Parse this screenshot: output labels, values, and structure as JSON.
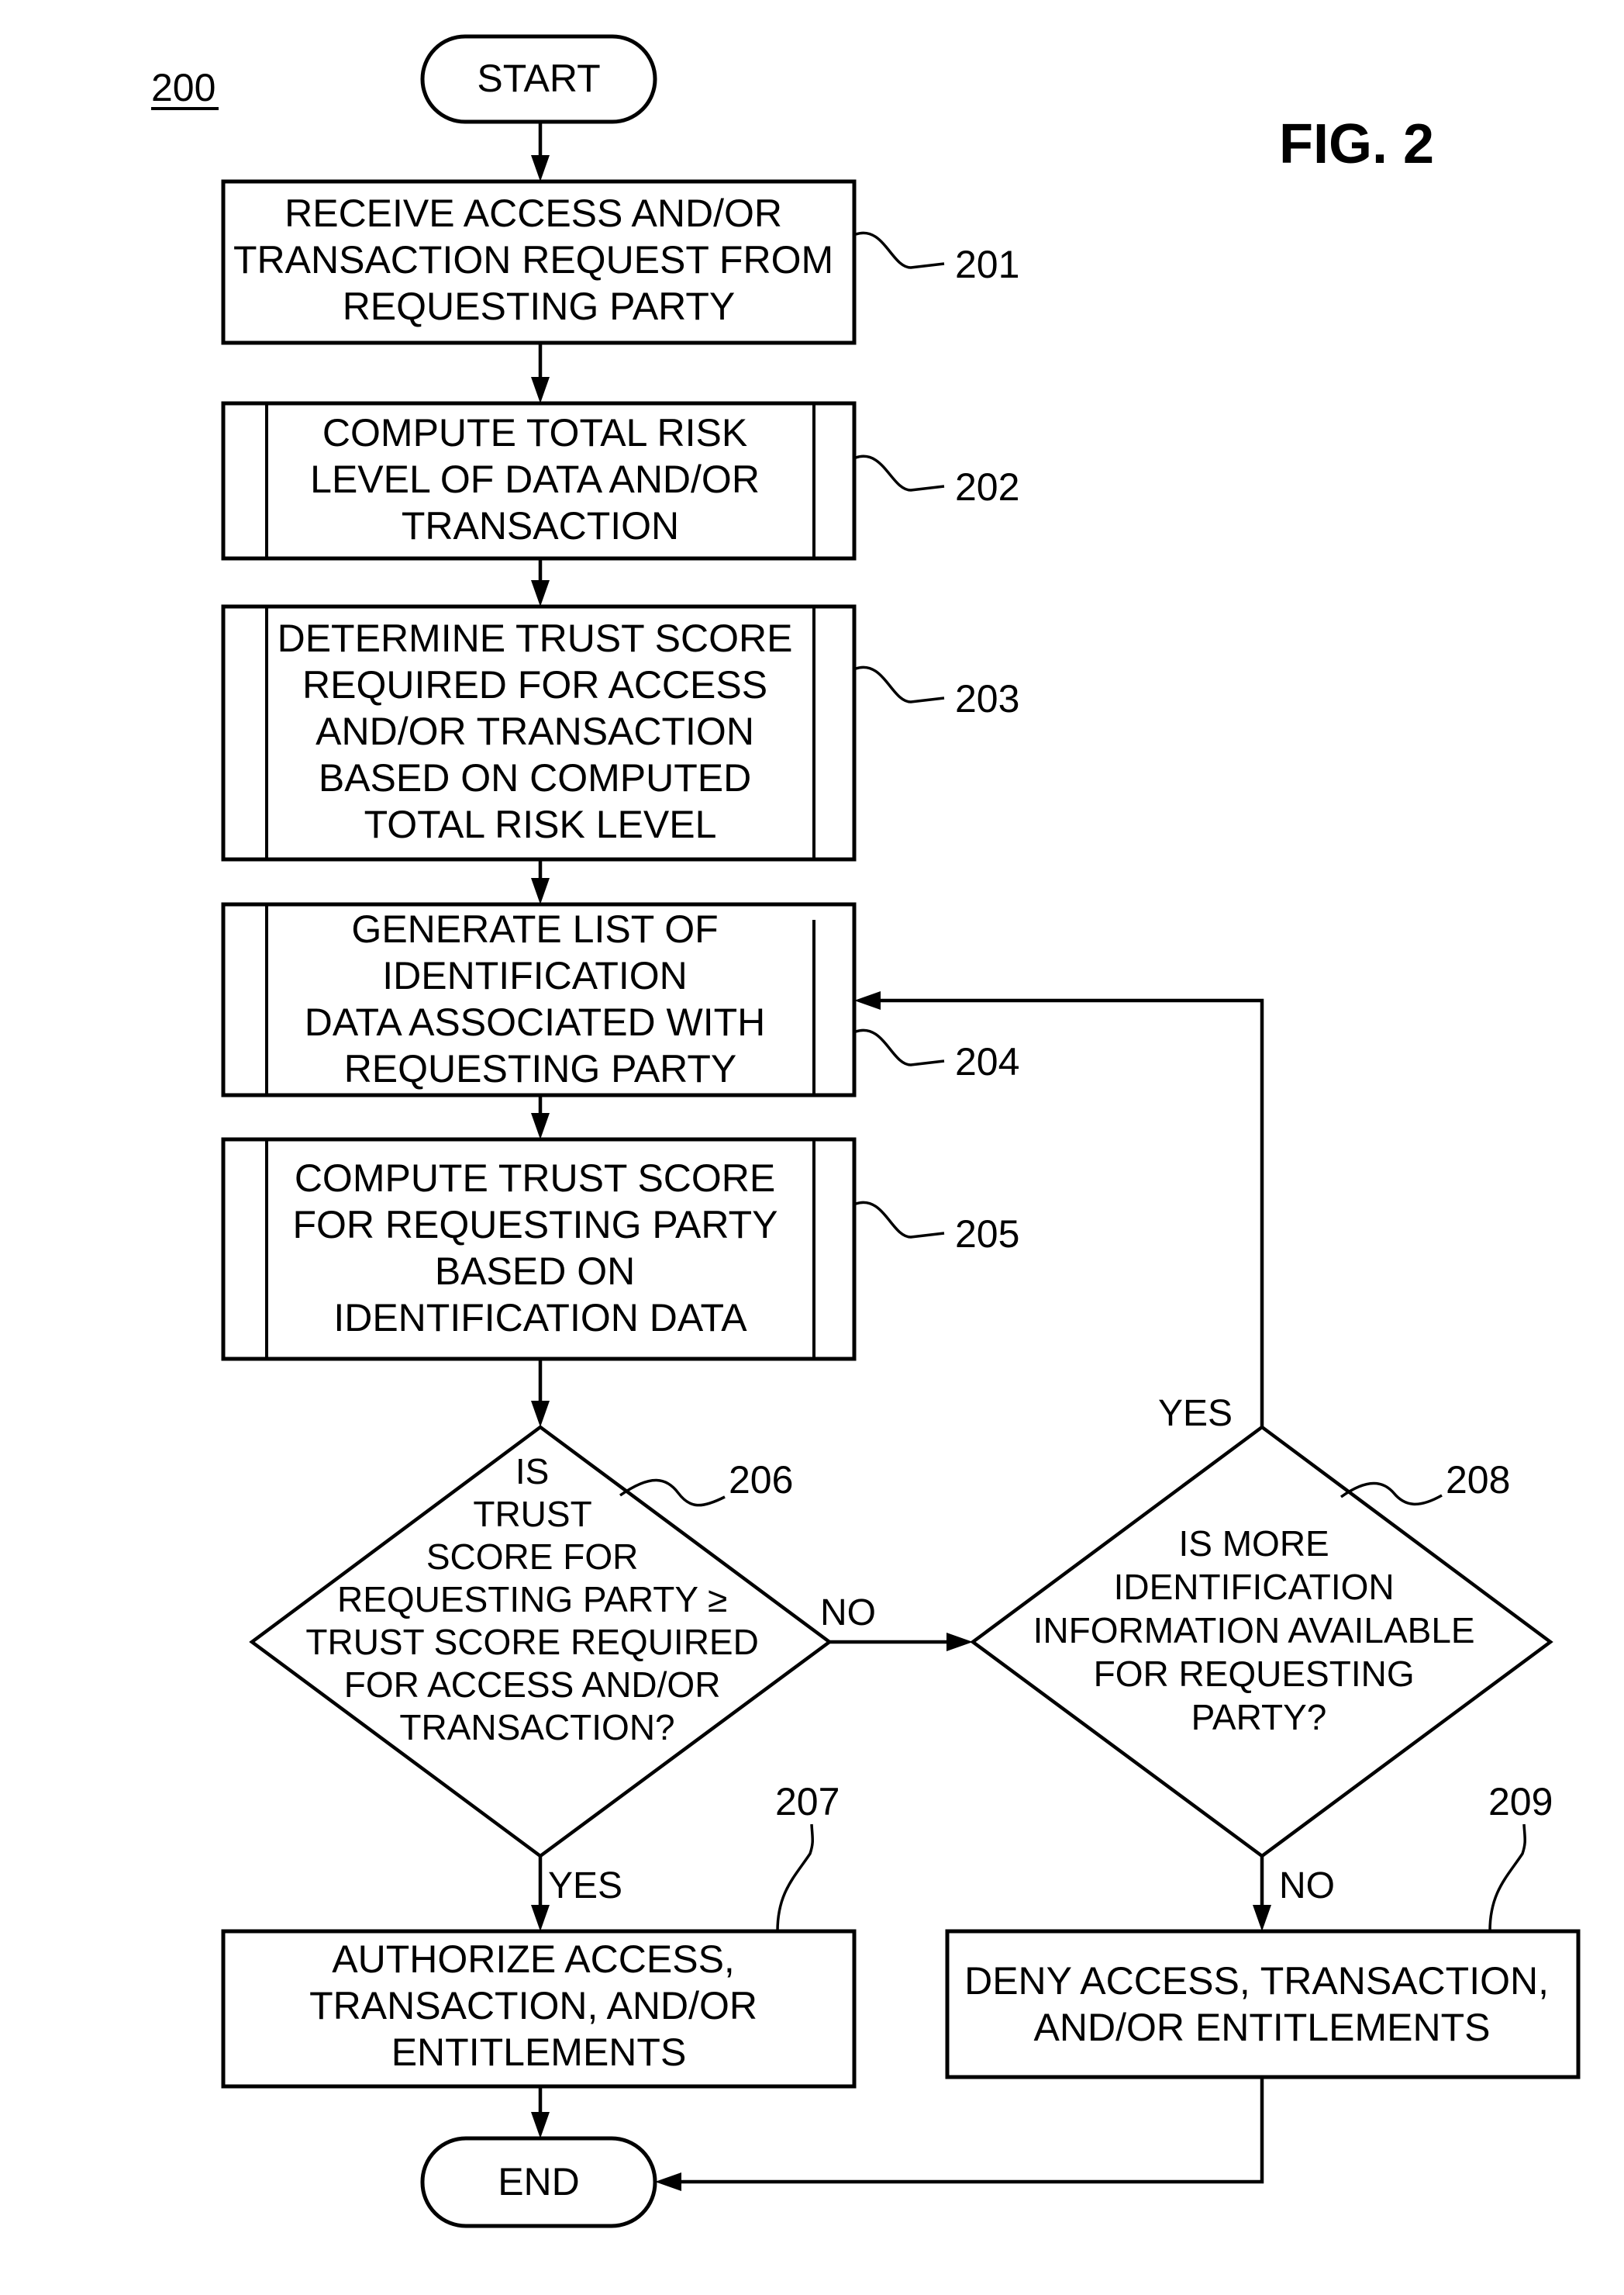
{
  "figure": {
    "number_label": "200",
    "title": "FIG. 2"
  },
  "terminals": {
    "start": "START",
    "end": "END"
  },
  "steps": [
    {
      "ref": "201",
      "lines": [
        "RECEIVE ACCESS AND/OR",
        "TRANSACTION REQUEST FROM",
        "REQUESTING PARTY"
      ]
    },
    {
      "ref": "202",
      "lines": [
        "COMPUTE TOTAL RISK",
        "LEVEL OF DATA AND/OR",
        "TRANSACTION"
      ]
    },
    {
      "ref": "203",
      "lines": [
        "DETERMINE TRUST SCORE",
        "REQUIRED FOR ACCESS",
        "AND/OR TRANSACTION",
        "BASED ON COMPUTED",
        "TOTAL RISK LEVEL"
      ]
    },
    {
      "ref": "204",
      "lines": [
        "GENERATE LIST OF",
        "IDENTIFICATION",
        "DATA ASSOCIATED WITH",
        "REQUESTING PARTY"
      ]
    },
    {
      "ref": "205",
      "lines": [
        "COMPUTE TRUST SCORE",
        "FOR REQUESTING PARTY",
        "BASED ON",
        "IDENTIFICATION DATA"
      ]
    }
  ],
  "decisions": [
    {
      "ref": "206",
      "lines": [
        "IS",
        "TRUST",
        "SCORE FOR",
        "REQUESTING PARTY ≥",
        "TRUST SCORE REQUIRED",
        "FOR ACCESS AND/OR",
        "TRANSACTION?"
      ],
      "yes_label": "YES",
      "no_label": "NO"
    },
    {
      "ref": "208",
      "lines": [
        "IS MORE",
        "IDENTIFICATION",
        "INFORMATION AVAILABLE",
        "FOR REQUESTING",
        "PARTY?"
      ],
      "yes_label": "YES",
      "no_label": "NO"
    }
  ],
  "outcomes": [
    {
      "ref": "207",
      "lines": [
        "AUTHORIZE ACCESS,",
        "TRANSACTION, AND/OR",
        "ENTITLEMENTS"
      ]
    },
    {
      "ref": "209",
      "lines": [
        "DENY ACCESS, TRANSACTION,",
        "AND/OR ENTITLEMENTS"
      ]
    }
  ]
}
